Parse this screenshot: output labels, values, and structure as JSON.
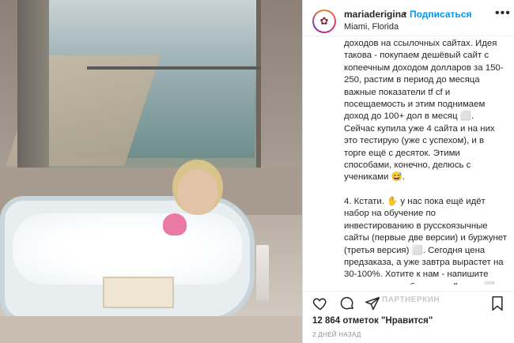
{
  "post": {
    "username": "mariaderigina",
    "separator": "•",
    "follow_label": "Подписаться",
    "location": "Miami, Florida",
    "more_label": "•••"
  },
  "caption": {
    "paragraph_1": "доходов на ссылочных сайтах. Идея такова - покупаем дешёвый сайт с копеечным доходом долларов за 150-250, растим в период до месяца важные показатели tf cf и посещаемость и этим поднимаем доход до 100+ дол в месяц ⬜. Сейчас купила уже 4 сайта и на них это тестирую (уже с успехом), и в торге ещё с десяток. Этими способами, конечно, делюсь с учениками 😅.",
    "paragraph_2": "4. Кстати. ✋ у нас пока ещё идёт набор на обучение по инвестированию в русскоязычные сайты (первые две версии) и буржунет (третья версия) ⬜. Сегодня цена предзаказа, а уже завтра вырастет на 30-100%. Хотите к нам - напишите мне личное сообщение в Директ ⬜"
  },
  "actions": {
    "like_icon": "heart-icon",
    "comment_icon": "comment-icon",
    "share_icon": "paper-plane-icon",
    "save_icon": "bookmark-icon",
    "watermark": "ПАРТНЕРКИН"
  },
  "stats": {
    "likes_text": "12 864 отметок \"Нравится\"",
    "date_text": "2 ДНЕЙ НАЗАД"
  }
}
